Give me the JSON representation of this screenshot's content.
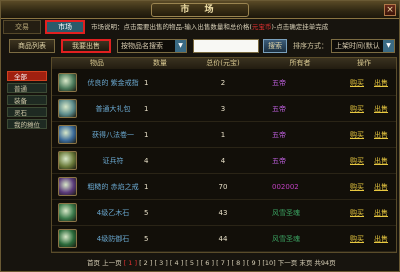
{
  "window": {
    "title": "市 场",
    "close": "×"
  },
  "tabs": {
    "exchange": "交易",
    "market": "市场"
  },
  "hint": {
    "before": "市场说明：点击需要出售的物品-输入出售数量和总价格(",
    "red": "元宝币",
    "after": ")-点击确定挂单完成"
  },
  "toolbar": {
    "list_label": "商品列表",
    "sell_label": "我要出售",
    "search_select": "按物品名搜索",
    "search_value": "",
    "search_label": "搜索",
    "sort_label": "排序方式：",
    "sort_select": "上架时间(默认"
  },
  "sidebar": [
    {
      "label": "全部",
      "active": true
    },
    {
      "label": "普通",
      "active": false
    },
    {
      "label": "装备",
      "active": false
    },
    {
      "label": "灵石",
      "active": false
    },
    {
      "label": "我的摊位",
      "active": false
    }
  ],
  "table": {
    "headers": {
      "item": "物品",
      "qty": "数量",
      "price": "总价(元宝)",
      "owner": "所有者",
      "op": "操作"
    },
    "buy": "购买",
    "sell": "出售",
    "rows": [
      {
        "icon": "green-book-icon",
        "name": "优良的 紫金戒指",
        "qty": "1",
        "price": "2",
        "owner": "五帝",
        "owner_color": "#c060e0",
        "icon_color": "#4a7a5a"
      },
      {
        "icon": "jade-stone-icon",
        "name": "普通大礼包",
        "qty": "1",
        "price": "3",
        "owner": "五帝",
        "owner_color": "#c060e0",
        "icon_color": "#5a8a8a"
      },
      {
        "icon": "blue-orb-icon",
        "name": "获得八法卷一",
        "qty": "1",
        "price": "1",
        "owner": "五帝",
        "owner_color": "#c060e0",
        "icon_color": "#3a6a9a"
      },
      {
        "icon": "scroll-icon",
        "name": "证兵符",
        "qty": "4",
        "price": "4",
        "owner": "五帝",
        "owner_color": "#c060e0",
        "icon_color": "#6a7a3a"
      },
      {
        "icon": "ring-icon",
        "name": "粗糙的 赤焰之戒",
        "qty": "1",
        "price": "70",
        "owner": "002002",
        "owner_color": "#c040c0",
        "icon_color": "#5a3a7a"
      },
      {
        "icon": "dragon-orb-icon",
        "name": "4级乙木石",
        "qty": "5",
        "price": "43",
        "owner": "风雪圣魂",
        "owner_color": "#3aa060",
        "icon_color": "#3a7a4a"
      },
      {
        "icon": "dragon-orb-icon",
        "name": "4级防御石",
        "qty": "5",
        "price": "44",
        "owner": "风雪圣魂",
        "owner_color": "#3aa060",
        "icon_color": "#2a6a3a"
      }
    ]
  },
  "pager": {
    "first": "首页",
    "prev": "上一页",
    "current": "[ 1 ]",
    "pages": "[ 2 ] [ 3 ] [ 4 ] [ 5 ] [ 6 ] [ 7 ] [ 8 ] [ 9 ] [10]",
    "next": "下一页",
    "last": "末页",
    "total": "共94页"
  }
}
